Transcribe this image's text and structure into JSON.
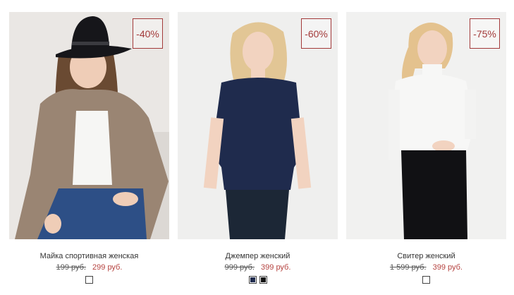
{
  "products": [
    {
      "name": "Майка спортивная женская",
      "old_price": "199 руб.",
      "new_price": "299 руб.",
      "discount": "-40%",
      "colors": [
        "#ffffff"
      ]
    },
    {
      "name": "Джемпер женский",
      "old_price": "999 руб.",
      "new_price": "399 руб.",
      "discount": "-60%",
      "colors": [
        "#1f2b4d",
        "#111111"
      ]
    },
    {
      "name": "Свитер женский",
      "old_price": "1 599 руб.",
      "new_price": "399 руб.",
      "discount": "-75%",
      "colors": [
        "#ffffff"
      ]
    }
  ],
  "theme": {
    "accent": "#b5423f",
    "badge_border": "#a33a3a"
  }
}
